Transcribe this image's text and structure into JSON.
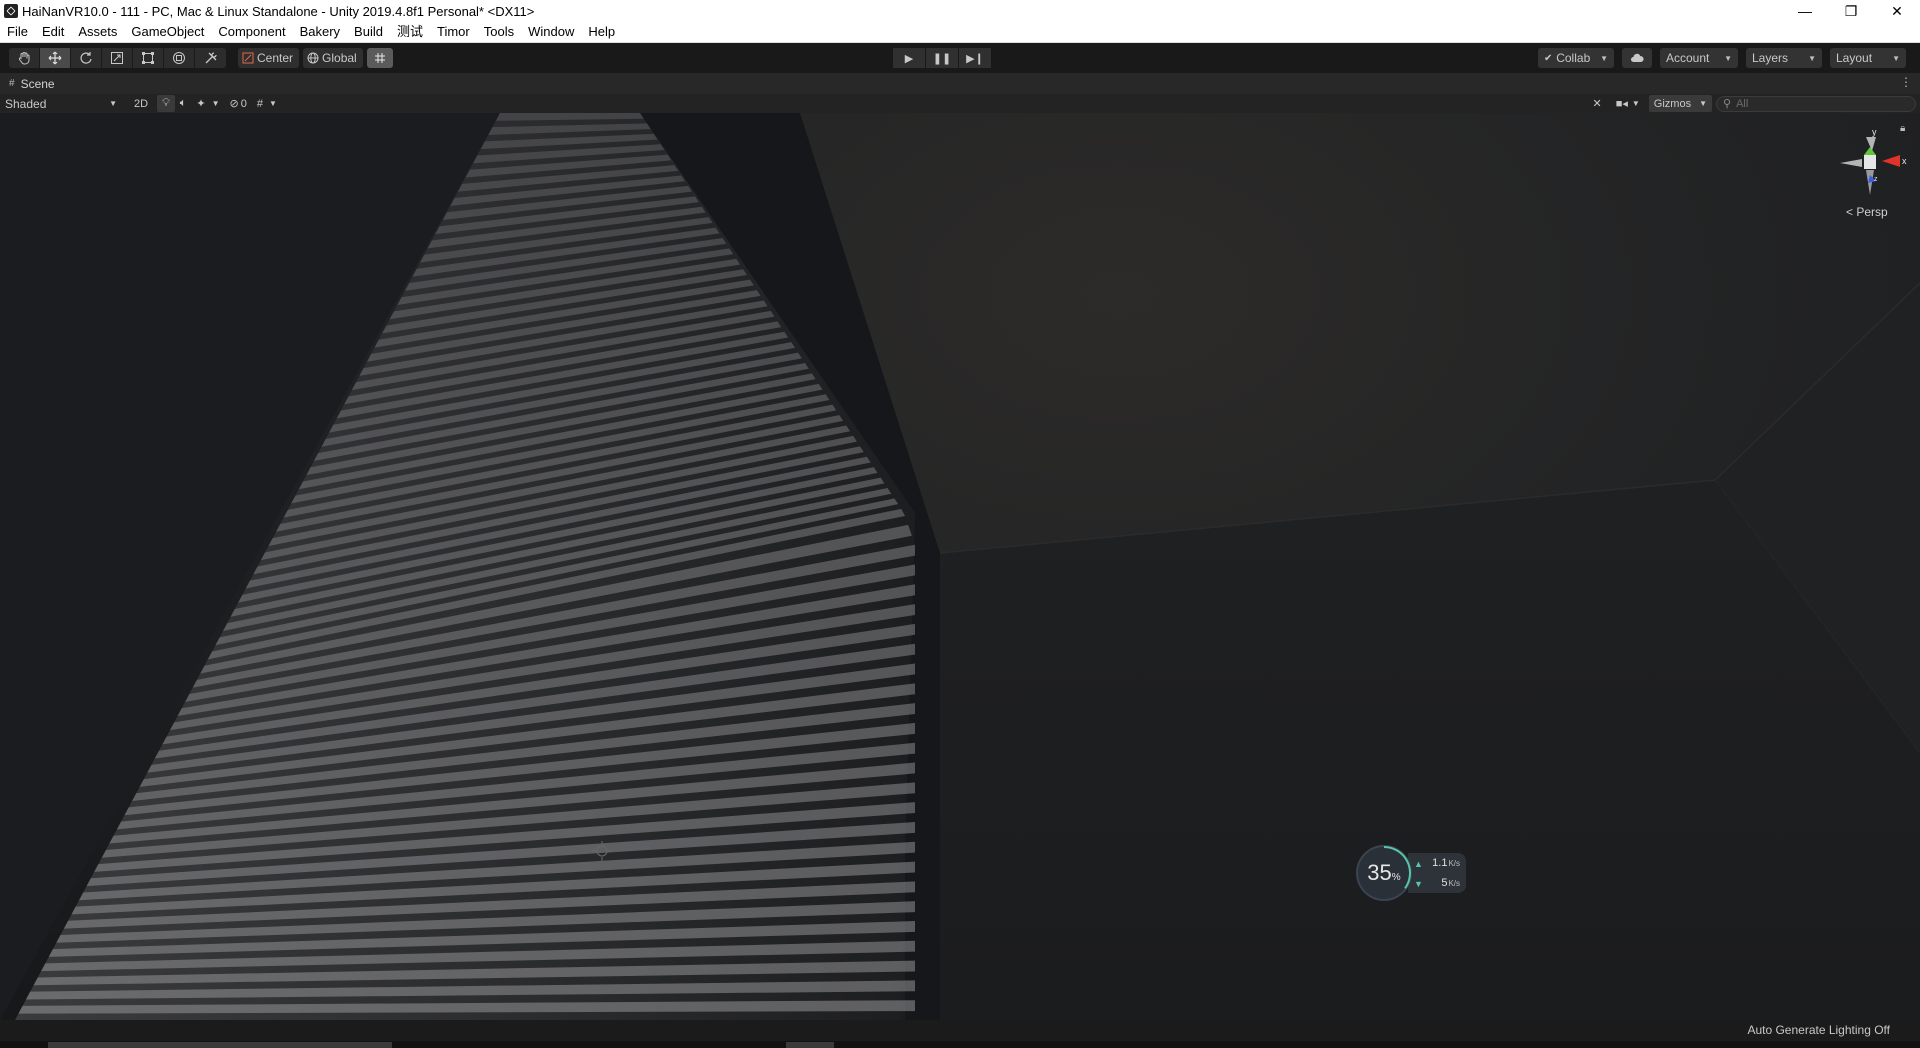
{
  "window": {
    "title": "HaiNanVR10.0 - 111 - PC, Mac & Linux Standalone - Unity 2019.4.8f1 Personal* <DX11>",
    "minimize": "—",
    "maximize": "❐",
    "close": "✕"
  },
  "menu": [
    "File",
    "Edit",
    "Assets",
    "GameObject",
    "Component",
    "Bakery",
    "Build",
    "测试",
    "Timor",
    "Tools",
    "Window",
    "Help"
  ],
  "toolbar": {
    "center_label": "Center",
    "global_label": "Global",
    "collab_label": "Collab",
    "account_label": "Account",
    "layers_label": "Layers",
    "layout_label": "Layout"
  },
  "scene": {
    "tab_label": "Scene",
    "shading_mode": "Shaded",
    "mode_2d": "2D",
    "hidden_count": "0",
    "gizmos_label": "Gizmos",
    "search_placeholder": "All",
    "persp_label": "Persp",
    "gizmo_y": "y",
    "gizmo_x": "x",
    "gizmo_z": "z"
  },
  "net_monitor": {
    "percent": "35",
    "percent_sign": "%",
    "upload": "1.1",
    "download": "5",
    "unit": "K/s"
  },
  "status": {
    "lighting": "Auto Generate Lighting Off"
  },
  "colors": {
    "accent_active": "#5b5b5b",
    "net_ring": "#58c6a8"
  }
}
